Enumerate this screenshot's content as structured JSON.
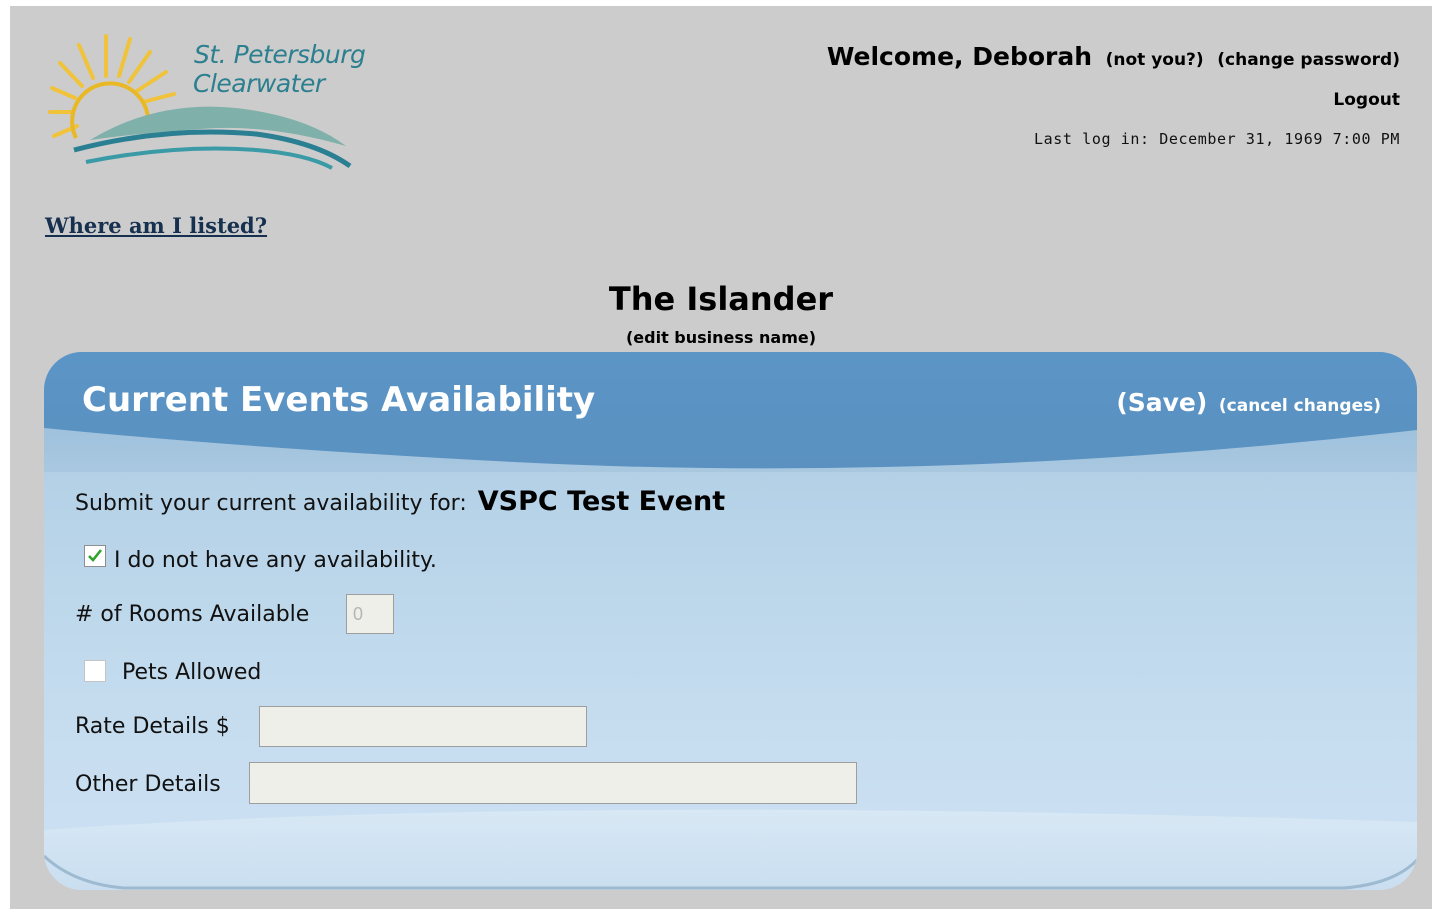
{
  "header": {
    "logo_line1": "St. Petersburg",
    "logo_line2": "Clearwater",
    "welcome": "Welcome, Deborah",
    "not_you": "(not you?)",
    "change_password": "(change password)",
    "logout": "Logout",
    "last_login": "Last log in: December 31, 1969 7:00 PM"
  },
  "nav": {
    "where_listed": "Where am I listed?"
  },
  "business": {
    "name": "The Islander",
    "edit_link": "(edit business name)"
  },
  "panel": {
    "title": "Current Events Availability",
    "save": "(Save)",
    "cancel": "(cancel changes)"
  },
  "form": {
    "submit_prefix": "Submit your current availability for:",
    "event_name": "VSPC Test Event",
    "no_availability_label": "I do not have any availability.",
    "no_availability_checked": true,
    "rooms_label": "# of Rooms Available",
    "rooms_value": "0",
    "pets_label": "Pets Allowed",
    "pets_checked": false,
    "rate_label": "Rate Details $",
    "rate_value": "",
    "other_label": "Other Details",
    "other_value": ""
  },
  "colors": {
    "page_bg": "#cccccc",
    "panel_header": "#5a93c3",
    "panel_body": "#b7d3e8",
    "link_dark": "#16304f",
    "logo_text": "#2c7f8f"
  }
}
